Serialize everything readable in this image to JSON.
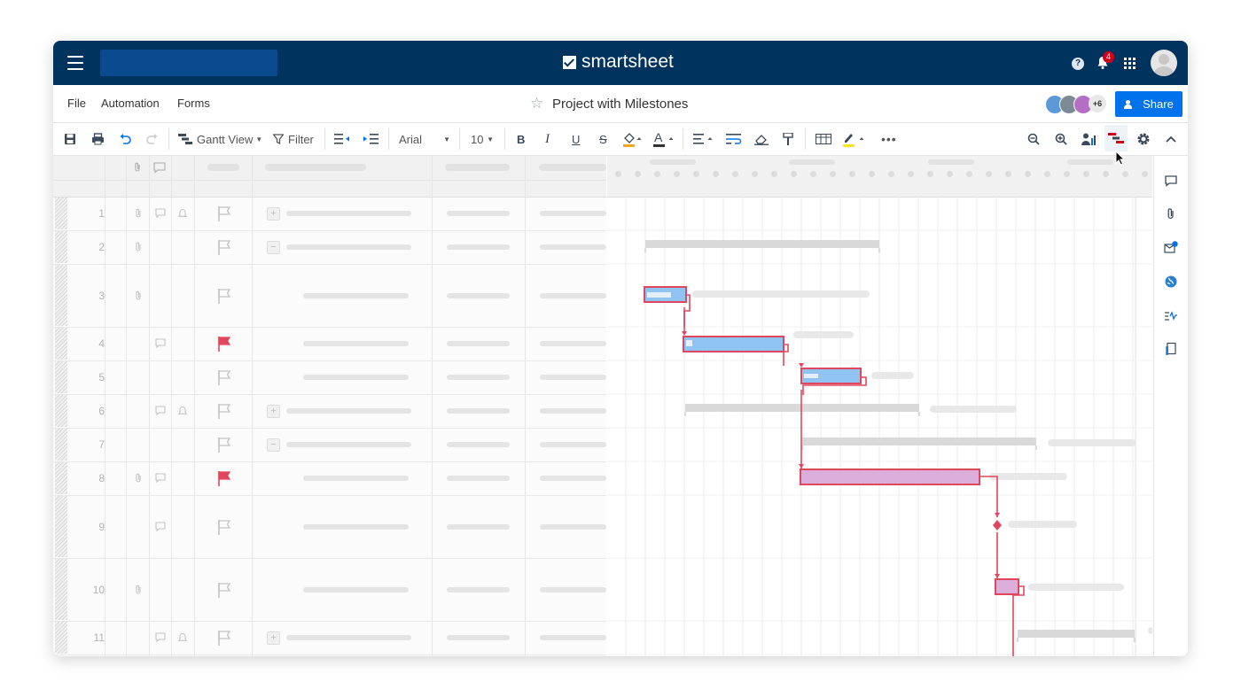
{
  "header": {
    "brand": "smartsheet",
    "notifications_count": "4",
    "help_label": "?"
  },
  "menu": {
    "items": [
      "File",
      "Automation",
      "Forms"
    ],
    "sheet_title": "Project with Milestones",
    "collaborators_more": "+6",
    "share_label": "Share"
  },
  "toolbar": {
    "view_label": "Gantt View",
    "filter_label": "Filter",
    "font_name": "Arial",
    "font_size": "10",
    "more_label": "•••"
  },
  "grid": {
    "rows": [
      {
        "num": "1"
      },
      {
        "num": "2"
      },
      {
        "num": "3"
      },
      {
        "num": "4"
      },
      {
        "num": "5"
      },
      {
        "num": "6"
      },
      {
        "num": "7"
      },
      {
        "num": "8"
      },
      {
        "num": "9"
      },
      {
        "num": "10"
      },
      {
        "num": "11"
      }
    ],
    "flag_red_rows": [
      "4",
      "8"
    ]
  },
  "colors": {
    "topbar": "#00335e",
    "share": "#0073ec",
    "task_bar_blue": "#8fc3f2",
    "task_bar_pink": "#dcaedb",
    "critical_path": "#e0475e",
    "flag_red": "#e0475e"
  },
  "icons": [
    "hamburger-icon",
    "help-icon",
    "bell-icon",
    "apps-icon",
    "avatar",
    "star-icon",
    "save-icon",
    "print-icon",
    "undo-icon",
    "redo-icon",
    "gantt-icon",
    "filter-icon",
    "outdent-icon",
    "indent-icon",
    "bold-icon",
    "italic-icon",
    "underline-icon",
    "strikethrough-icon",
    "fill-color-icon",
    "text-color-icon",
    "align-icon",
    "wrap-icon",
    "eraser-icon",
    "format-painter-icon",
    "table-icon",
    "highlight-icon",
    "zoom-out-icon",
    "zoom-in-icon",
    "resource-icon",
    "critical-path-icon",
    "settings-icon",
    "collapse-icon",
    "comment-icon",
    "attachment-icon",
    "update-request-icon",
    "publish-icon",
    "activity-icon",
    "summary-icon"
  ]
}
